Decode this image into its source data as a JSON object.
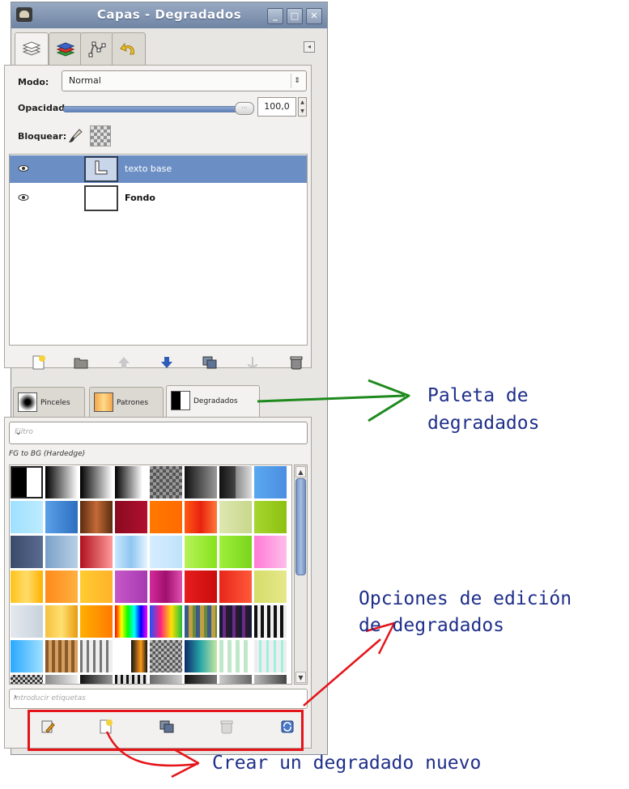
{
  "window": {
    "title": "Capas - Degradados"
  },
  "layers_panel": {
    "mode_label": "Modo:",
    "mode_value": "Normal",
    "opacity_label": "Opacidad:",
    "opacity_value": "100,0",
    "lock_label": "Bloquear:",
    "layers": [
      {
        "name": "texto base",
        "selected": true,
        "visible": true
      },
      {
        "name": "Fondo",
        "selected": false,
        "visible": true
      }
    ]
  },
  "bottom_tabs": [
    {
      "label": "Pinceles"
    },
    {
      "label": "Patrones"
    },
    {
      "label": "Degradados",
      "active": true
    }
  ],
  "gradients_panel": {
    "filter_placeholder": "Filtro",
    "selected_gradient": "FG to BG (Hardedge)",
    "tags_placeholder": "Introducir etiquetas"
  },
  "annotations": {
    "palette_line1": "Paleta de",
    "palette_line2": "degradados",
    "edit_line1": "Opciones de edición",
    "edit_line2": "de degradados",
    "create_new": "Crear un degradado nuevo"
  },
  "colors": {
    "selection": "#6b8fc5",
    "annotation_text": "#1f2f8a",
    "green_arrow": "#1e8a1e",
    "red_arrow": "#e5141a"
  }
}
